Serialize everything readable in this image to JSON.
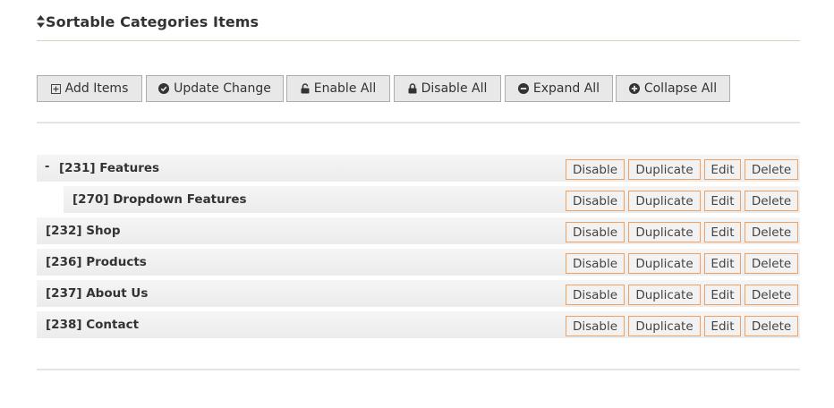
{
  "section": {
    "title": "Sortable Categories Items"
  },
  "toolbar": {
    "add_items": "Add Items",
    "update_change": "Update Change",
    "enable_all": "Enable All",
    "disable_all": "Disable All",
    "expand_all": "Expand All",
    "collapse_all": "Collapse All"
  },
  "tree": {
    "collapse_toggle": "-",
    "items": [
      {
        "label": "[231] Features",
        "level": 0,
        "has_children": true,
        "expanded": true
      },
      {
        "label": "[270] Dropdown Features",
        "level": 1,
        "has_children": false
      },
      {
        "label": "[232] Shop",
        "level": 0,
        "has_children": false
      },
      {
        "label": "[236] Products",
        "level": 0,
        "has_children": false
      },
      {
        "label": "[237] About Us",
        "level": 0,
        "has_children": false
      },
      {
        "label": "[238] Contact",
        "level": 0,
        "has_children": false
      }
    ]
  },
  "row_actions": {
    "disable": "Disable",
    "duplicate": "Duplicate",
    "edit": "Edit",
    "delete": "Delete"
  },
  "icons": {
    "title": "sort-icon",
    "add_items": "plus-square-icon",
    "update_change": "check-circle-icon",
    "enable_all": "unlock-icon",
    "disable_all": "lock-icon",
    "expand_all": "minus-circle-icon",
    "collapse_all": "plus-circle-icon"
  },
  "colors": {
    "action_border": "#f0a060",
    "toolbar_bg": "#e8e8e8",
    "row_bg": "#efefef",
    "text": "#333333"
  }
}
